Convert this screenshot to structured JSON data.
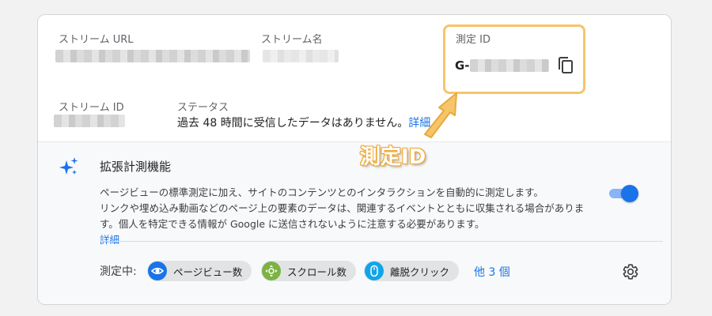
{
  "stream": {
    "url_label": "ストリーム URL",
    "name_label": "ストリーム名",
    "id_label": "ストリーム ID",
    "status_label": "ステータス",
    "status_text": "過去 48 時間に受信したデータはありません。",
    "status_link": "詳細"
  },
  "measurement": {
    "label": "測定 ID",
    "prefix": "G-"
  },
  "enhanced": {
    "title": "拡張計測機能",
    "desc_lines": [
      "ページビューの標準測定に加え、サイトのコンテンツとのインタラクションを自動的に測定します。",
      "リンクや埋め込み動画などのページ上の要素のデータは、関連するイベントとともに収集される場合がありま",
      "す。個人を特定できる情報が Google に送信されないように注意する必要があります。"
    ],
    "desc_link": "詳細",
    "toggle_on": true,
    "measuring_label": "測定中:",
    "chips": [
      {
        "label": "ページビュー数",
        "icon": "eye-icon",
        "color": "#1a73e8"
      },
      {
        "label": "スクロール数",
        "icon": "scroll-target-icon",
        "color": "#7cb342"
      },
      {
        "label": "離脱クリック",
        "icon": "mouse-icon",
        "color": "#12a4e8"
      }
    ],
    "more_link": "他 3 個"
  },
  "annotation": {
    "label": "測定ID",
    "color": "#f6c56a"
  },
  "colors": {
    "accent": "#1a73e8",
    "highlight": "#f6c56a"
  }
}
